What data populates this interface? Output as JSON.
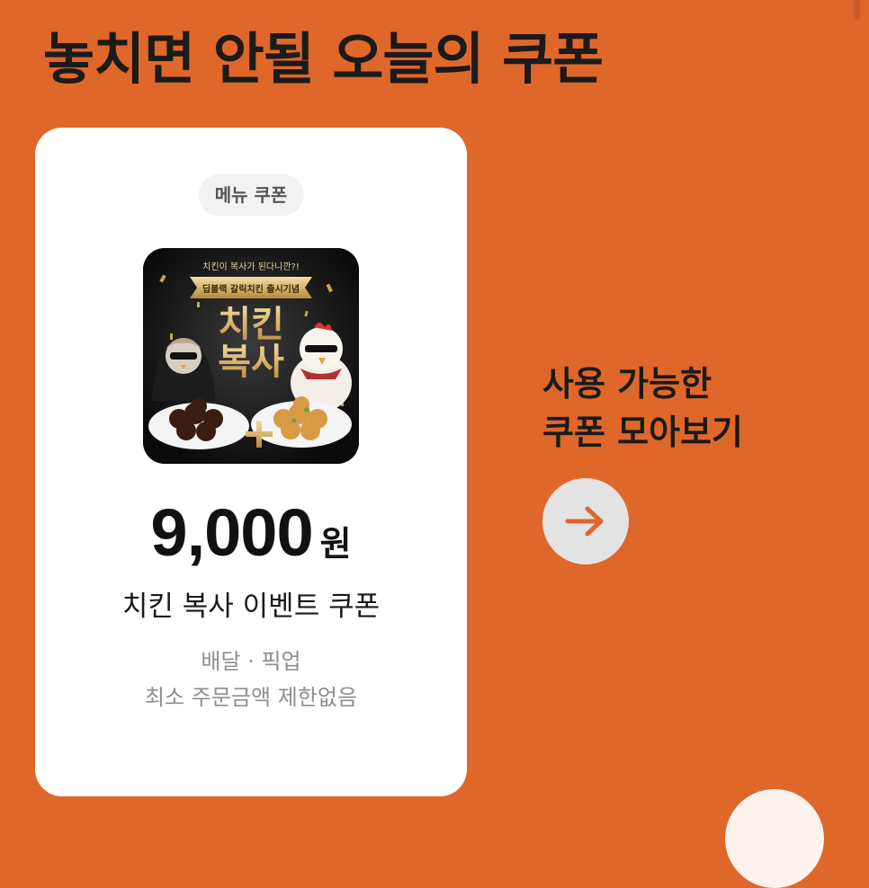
{
  "header": {
    "title": "놓치면 안될 오늘의 쿠폰"
  },
  "coupon": {
    "badge": "메뉴 쿠폰",
    "image": {
      "top_text": "치킨이 복사가 된다니깐?!",
      "ribbon_text": "딥블랙 갈릭치킨 출시기념",
      "big_text_line1": "치킨",
      "big_text_line2": "복사"
    },
    "amount": "9,000",
    "amount_unit": "원",
    "name": "치킨 복사 이벤트 쿠폰",
    "order_types": "배달 · 픽업",
    "min_order": "최소 주문금액 제한없음"
  },
  "side": {
    "line1": "사용 가능한",
    "line2": "쿠폰 모아보기"
  },
  "colors": {
    "background": "#E0672A",
    "card": "#FFFFFF",
    "accent": "#E0672A",
    "arrow_button_bg": "#E3E3E3"
  },
  "icons": {
    "arrow": "arrow-right-icon"
  }
}
